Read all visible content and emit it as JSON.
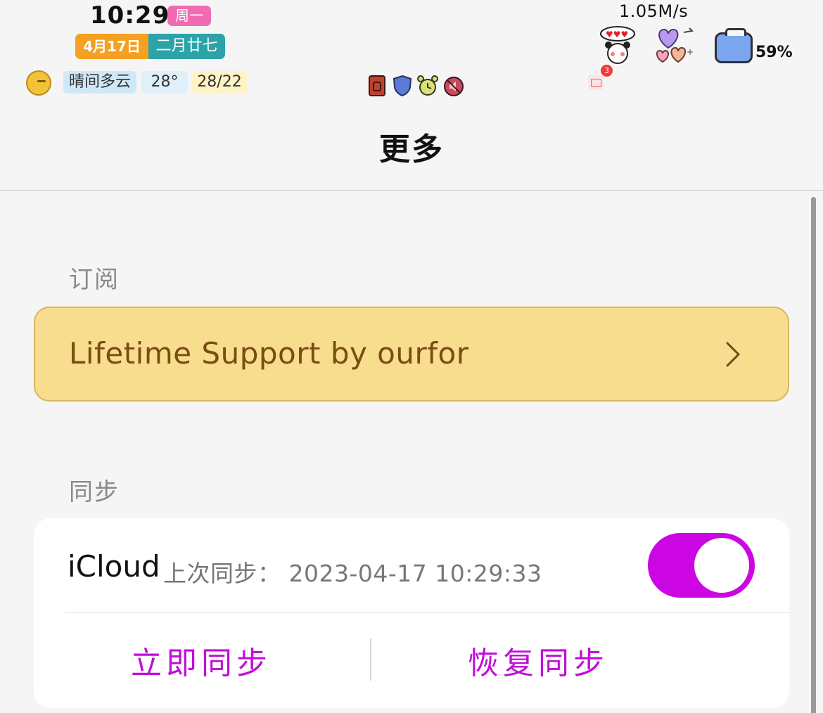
{
  "status_bar": {
    "time": "10:29",
    "weekday": "周一",
    "date": "4月17日",
    "lunar_date": "二月廿七",
    "weather": {
      "condition": "晴间多云",
      "temperature": "28°",
      "range": "28/22"
    },
    "net_speed": "1.05M/s",
    "mail_badge_count": "3",
    "battery_percent": "59%",
    "icons": [
      "moon-weather-icon",
      "sim-card-icon",
      "shield-icon",
      "alarm-clock-icon",
      "mute-icon",
      "mail-icon",
      "panda-sticker-icon",
      "hearts-sticker-icon",
      "battery-icon"
    ]
  },
  "nav": {
    "title": "更多"
  },
  "subscription": {
    "section_title": "订阅",
    "support_label": "Lifetime Support by ourfor"
  },
  "sync": {
    "section_title": "同步",
    "service_name": "iCloud",
    "last_sync": "上次同步： 2023-04-17 10:29:33",
    "toggle_on": true,
    "sync_now_label": "立即同步",
    "restore_label": "恢复同步"
  },
  "colors": {
    "accent": "#cc06e2",
    "support_card_bg": "#f7dd8d",
    "support_text": "#7a4b12",
    "background": "#f5f5f5"
  }
}
